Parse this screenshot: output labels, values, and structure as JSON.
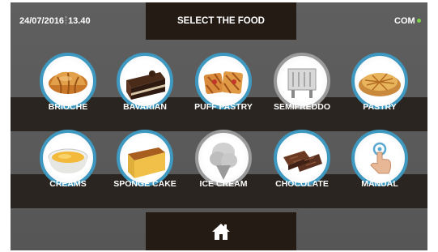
{
  "header": {
    "date": "24/07/2016",
    "time": "13.40",
    "title": "SELECT THE FOOD",
    "status": "COM",
    "status_color": "#7cd34a"
  },
  "foods": [
    {
      "label": "BRIOCHE",
      "icon": "brioche-icon"
    },
    {
      "label": "BAVARIAN",
      "icon": "bavarian-icon"
    },
    {
      "label": "PUFF PASTRY",
      "icon": "puff-pastry-icon"
    },
    {
      "label": "SEMIFREDDO",
      "icon": "semifreddo-icon"
    },
    {
      "label": "PASTRY",
      "icon": "pastry-icon"
    },
    {
      "label": "CREAMS",
      "icon": "creams-icon"
    },
    {
      "label": "SPONGE CAKE",
      "icon": "sponge-cake-icon"
    },
    {
      "label": "ICE CREAM",
      "icon": "ice-cream-icon"
    },
    {
      "label": "CHOCOLATE",
      "icon": "chocolate-icon"
    },
    {
      "label": "MANUAL",
      "icon": "manual-icon"
    }
  ],
  "footer": {
    "icon": "home-icon"
  },
  "colors": {
    "accent_ring": "#3e98bf",
    "panel": "#241b14",
    "background": "#5b5b5b"
  }
}
